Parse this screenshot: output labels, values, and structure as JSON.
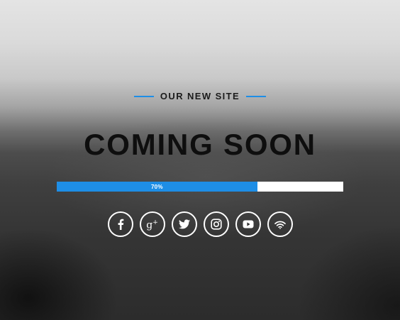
{
  "header": {
    "eyebrow": "OUR NEW SITE"
  },
  "hero": {
    "title": "COMING SOON"
  },
  "progress": {
    "percent": 70,
    "label": "70%"
  },
  "social": {
    "items": [
      {
        "name": "facebook",
        "icon": "facebook-icon"
      },
      {
        "name": "google-plus",
        "icon": "google-plus-icon",
        "glyph": "g",
        "plus": "+"
      },
      {
        "name": "twitter",
        "icon": "twitter-icon"
      },
      {
        "name": "instagram",
        "icon": "instagram-icon"
      },
      {
        "name": "youtube",
        "icon": "youtube-icon"
      },
      {
        "name": "rss",
        "icon": "wifi-icon"
      }
    ]
  },
  "colors": {
    "accent": "#1e8ee6",
    "track": "#ffffff",
    "title": "#0e0e0e",
    "icon_stroke": "#ffffff"
  }
}
